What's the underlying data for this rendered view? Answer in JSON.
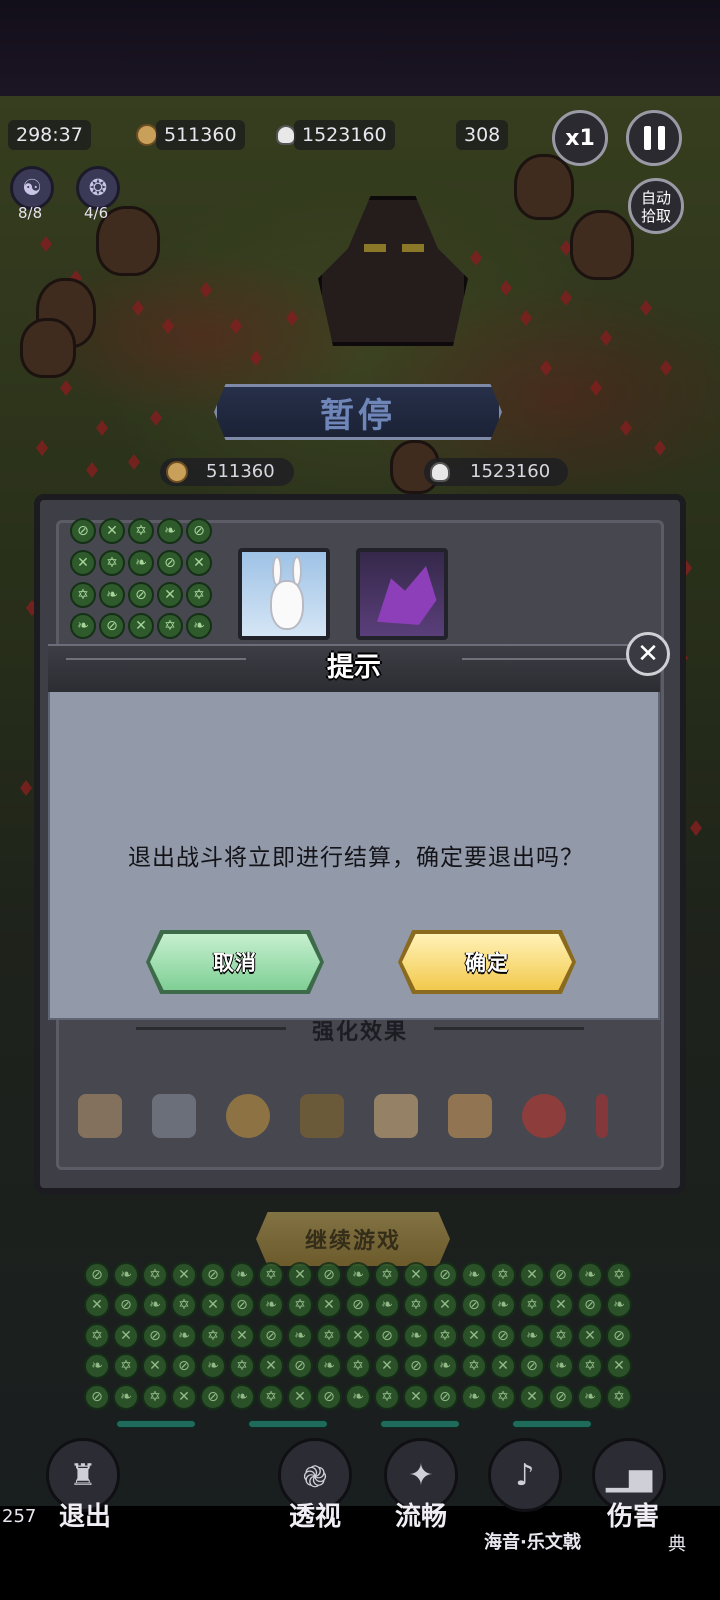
{
  "hud": {
    "timer": "298:37",
    "coins": "511360",
    "kills": "1523160",
    "level": "308",
    "speed_label": "x1",
    "auto_pickup_line1": "自动",
    "auto_pickup_line2": "拾取",
    "skill1_count": "8/8",
    "skill2_count": "4/6"
  },
  "pause": {
    "banner_title": "暂停",
    "coins": "511360",
    "kills": "1523160",
    "enhancement_label": "强化效果",
    "continue_label": "继续游戏"
  },
  "dialog": {
    "title": "提示",
    "message": "退出战斗将立即进行结算，确定要退出吗？",
    "cancel_label": "取消",
    "confirm_label": "确定",
    "close_icon": "close-icon"
  },
  "bottom_bar": {
    "exit_label": "退出",
    "reveal_label": "透视",
    "smooth_label": "流畅",
    "audio_label": "海音·乐文戟",
    "damage_label": "伤害",
    "damage_sub": "典",
    "left_number": "257"
  },
  "colors": {
    "dialog_body": "#929aaa",
    "cancel_button": "#7fcf95",
    "confirm_button": "#f2c94c"
  }
}
